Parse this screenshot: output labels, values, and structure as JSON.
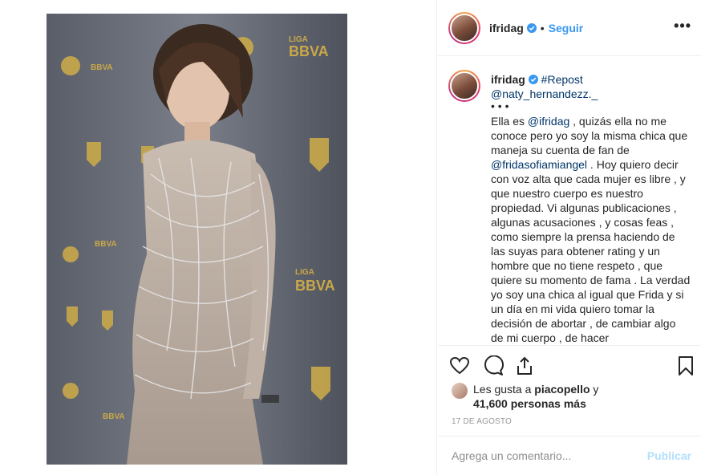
{
  "post": {
    "username": "ifridag",
    "dot": "•",
    "follow_label": "Seguir",
    "more_icon": "more-options-icon",
    "caption": {
      "author": "ifridag",
      "hashtag": "#Repost",
      "mention": "@naty_hernandezz._",
      "dots": "• • •",
      "text_before_mention": "Ella es ",
      "mention_1": "@ifridag",
      "text_mid": " , quizás ella no me conoce pero yo soy la misma chica que maneja su cuenta de fan de ",
      "mention_2": "@fridasofiamiangel",
      "text_after": " . Hoy quiero decir con voz alta que cada mujer es libre , y que nuestro cuerpo es nuestro propiedad. Vi algunas publicaciones , algunas acusaciones , y cosas feas , como siempre la prensa haciendo de las suyas para obtener rating y un hombre que no tiene respeto , que quiere su momento de fama . La verdad yo soy una chica al igual que Frida y si un día en mi vida quiero tomar la decisión de abortar , de cambiar algo de mi cuerpo , de hacer"
    },
    "likes": {
      "prefix": "Les gusta a ",
      "user": "piacopello",
      "suffix": " y",
      "count": "41,600 personas más"
    },
    "date": "17 DE AGOSTO",
    "comment": {
      "placeholder": "Agrega un comentario...",
      "post_label": "Publicar"
    },
    "backdrop_text": {
      "liga": "LIGA",
      "bbva": "BBVA"
    },
    "colors": {
      "link": "#3897f0",
      "verified": "#3897f0",
      "post_disabled": "#b2dffc"
    }
  }
}
